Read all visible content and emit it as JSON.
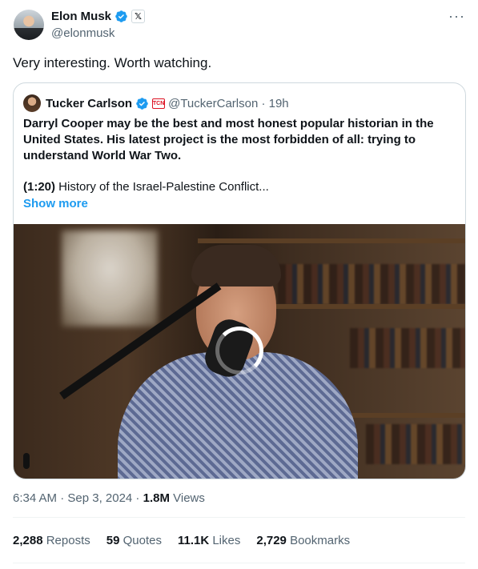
{
  "author": {
    "name": "Elon Musk",
    "handle": "@elonmusk",
    "badge_icon": "verified-icon",
    "affiliation_icon": "x-logo-icon"
  },
  "tweet": {
    "text": "Very interesting. Worth watching."
  },
  "quoted": {
    "name": "Tucker Carlson",
    "handle_time": "@TuckerCarlson · 19h",
    "body": "Darryl Cooper may be the best and most honest popular historian in the United States. His latest project is the most forbidden of all: trying to understand World War Two.",
    "sub_time": "(1:20)",
    "sub_text": " History of the Israel-Palestine Conflict...",
    "show_more": "Show more"
  },
  "meta": {
    "time": "6:34 AM · Sep 3, 2024 · ",
    "views_count": "1.8M",
    "views_label": " Views"
  },
  "stats": {
    "reposts_count": "2,288",
    "reposts_label": " Reposts",
    "quotes_count": "59",
    "quotes_label": " Quotes",
    "likes_count": "11.1K",
    "likes_label": " Likes",
    "bookmarks_count": "2,729",
    "bookmarks_label": " Bookmarks"
  },
  "colors": {
    "accent": "#1d9bf0",
    "muted": "#536471",
    "text": "#0f1419",
    "border": "#cfd9de"
  }
}
